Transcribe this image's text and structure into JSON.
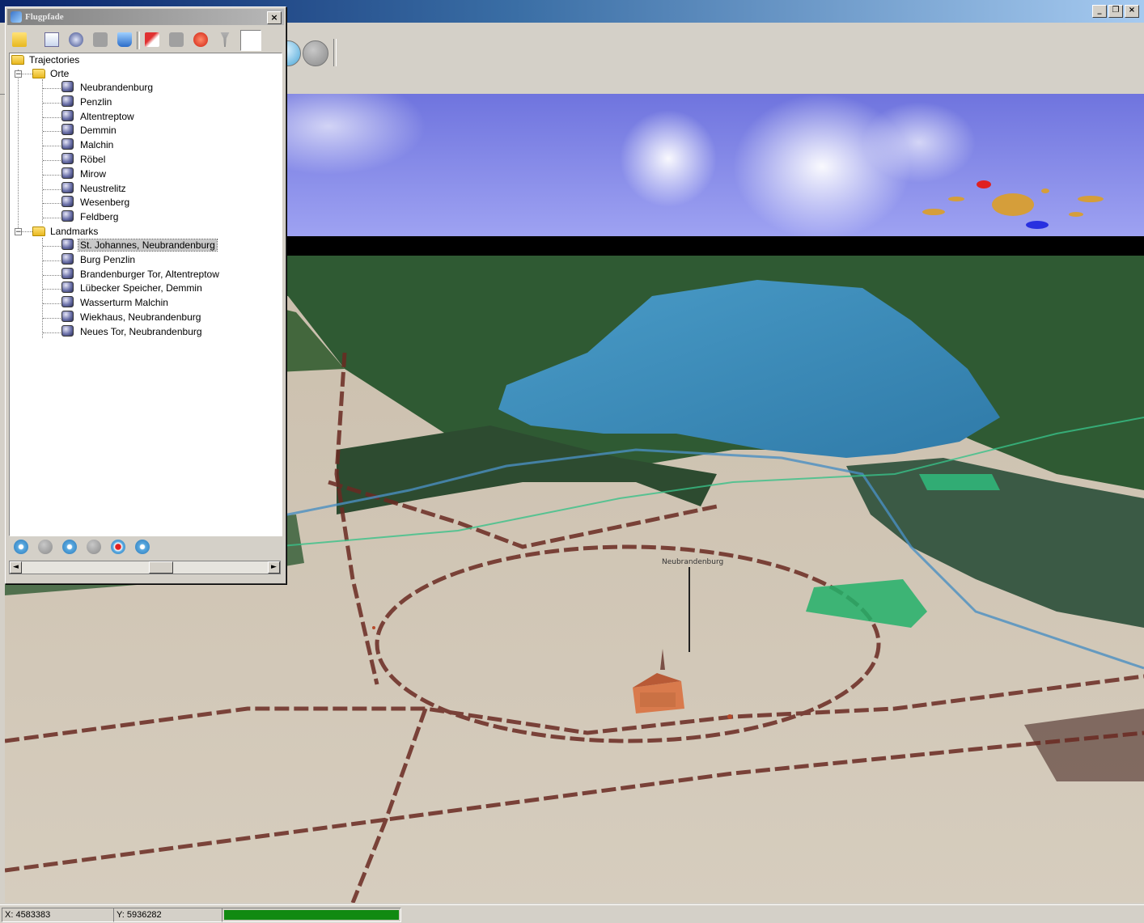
{
  "window": {
    "controls": [
      {
        "name": "minimize-button",
        "glyph": "_"
      },
      {
        "name": "restore-button",
        "glyph": "❐"
      },
      {
        "name": "close-button",
        "glyph": "×"
      }
    ]
  },
  "flugpfade": {
    "title": "Flugpfade",
    "close_glyph": "×",
    "toolbar_icons": [
      "folder-open-icon",
      "document-icon",
      "gear-icon",
      "layer-icon",
      "bucket-icon",
      "pencil-icon",
      "stop-icon",
      "delete-icon",
      "pin-icon"
    ],
    "tree": {
      "root": "Trajectories",
      "groups": [
        {
          "label": "Orte",
          "expander": "−",
          "items": [
            "Neubrandenburg",
            "Penzlin",
            "Altentreptow",
            "Demmin",
            "Malchin",
            "Röbel",
            "Mirow",
            "Neustrelitz",
            "Wesenberg",
            "Feldberg"
          ]
        },
        {
          "label": "Landmarks",
          "expander": "−",
          "items": [
            "St. Johannes, Neubrandenburg",
            "Burg Penzlin",
            "Brandenburger Tor, Altentreptow",
            "Lübecker Speicher, Demmin",
            "Wasserturm Malchin",
            "Wiekhaus, Neubrandenburg",
            "Neues Tor, Neubrandenburg"
          ],
          "selected_index": 0
        }
      ]
    },
    "playback_icons": [
      "play-icon",
      "pause-icon",
      "forward-icon",
      "stop-icon",
      "record-icon",
      "loop-icon"
    ],
    "scroll_left_glyph": "◄",
    "scroll_right_glyph": "►"
  },
  "scene": {
    "city_label": "Neubrandenburg"
  },
  "statusbar": {
    "x_coord": "X: 4583383",
    "y_coord": "Y: 5936282",
    "progress": 1.0
  },
  "colors": {
    "sky": "#8a8ee8",
    "water": "#3b88b8",
    "ground": "#cfc5b4",
    "forest": "#2f5a33",
    "road": "#6a2a22",
    "progress": "#118a11"
  }
}
